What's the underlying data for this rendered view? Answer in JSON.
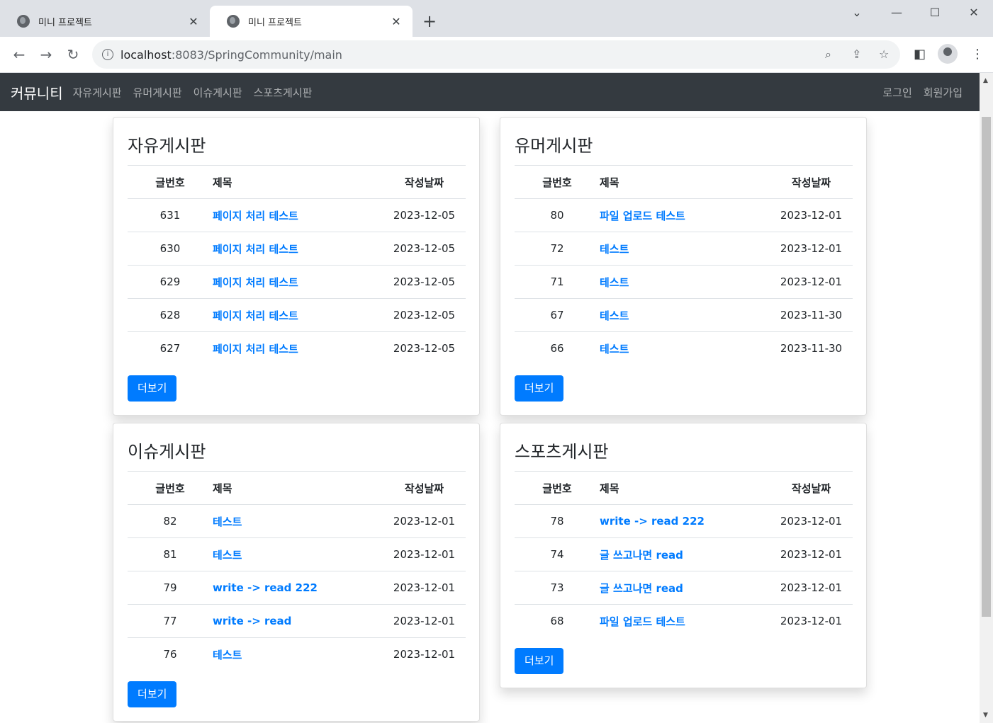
{
  "browser": {
    "tabs": [
      {
        "title": "미니 프로젝트"
      },
      {
        "title": "미니 프로젝트"
      }
    ],
    "url_host": "localhost",
    "url_rest": ":8083/SpringCommunity/main"
  },
  "navbar": {
    "brand": "커뮤니티",
    "links": [
      "자유게시판",
      "유머게시판",
      "이슈게시판",
      "스포츠게시판"
    ],
    "right": [
      "로그인",
      "회원가입"
    ]
  },
  "columns": {
    "num": "글번호",
    "title": "제목",
    "date": "작성날짜"
  },
  "more_label": "더보기",
  "boards": [
    {
      "title": "자유게시판",
      "rows": [
        {
          "num": "631",
          "title": "페이지 처리 테스트",
          "date": "2023-12-05"
        },
        {
          "num": "630",
          "title": "페이지 처리 테스트",
          "date": "2023-12-05"
        },
        {
          "num": "629",
          "title": "페이지 처리 테스트",
          "date": "2023-12-05"
        },
        {
          "num": "628",
          "title": "페이지 처리 테스트",
          "date": "2023-12-05"
        },
        {
          "num": "627",
          "title": "페이지 처리 테스트",
          "date": "2023-12-05"
        }
      ]
    },
    {
      "title": "유머게시판",
      "rows": [
        {
          "num": "80",
          "title": "파일 업로드 테스트",
          "date": "2023-12-01"
        },
        {
          "num": "72",
          "title": "테스트",
          "date": "2023-12-01"
        },
        {
          "num": "71",
          "title": "테스트",
          "date": "2023-12-01"
        },
        {
          "num": "67",
          "title": "테스트",
          "date": "2023-11-30"
        },
        {
          "num": "66",
          "title": "테스트",
          "date": "2023-11-30"
        }
      ]
    },
    {
      "title": "이슈게시판",
      "rows": [
        {
          "num": "82",
          "title": "테스트",
          "date": "2023-12-01"
        },
        {
          "num": "81",
          "title": "테스트",
          "date": "2023-12-01"
        },
        {
          "num": "79",
          "title": "write -> read 222",
          "date": "2023-12-01"
        },
        {
          "num": "77",
          "title": "write -> read",
          "date": "2023-12-01"
        },
        {
          "num": "76",
          "title": "테스트",
          "date": "2023-12-01"
        }
      ]
    },
    {
      "title": "스포츠게시판",
      "rows": [
        {
          "num": "78",
          "title": "write -> read 222",
          "date": "2023-12-01"
        },
        {
          "num": "74",
          "title": "글 쓰고나면 read",
          "date": "2023-12-01"
        },
        {
          "num": "73",
          "title": "글 쓰고나면 read",
          "date": "2023-12-01"
        },
        {
          "num": "68",
          "title": "파일 업로드 테스트",
          "date": "2023-12-01"
        }
      ]
    }
  ]
}
